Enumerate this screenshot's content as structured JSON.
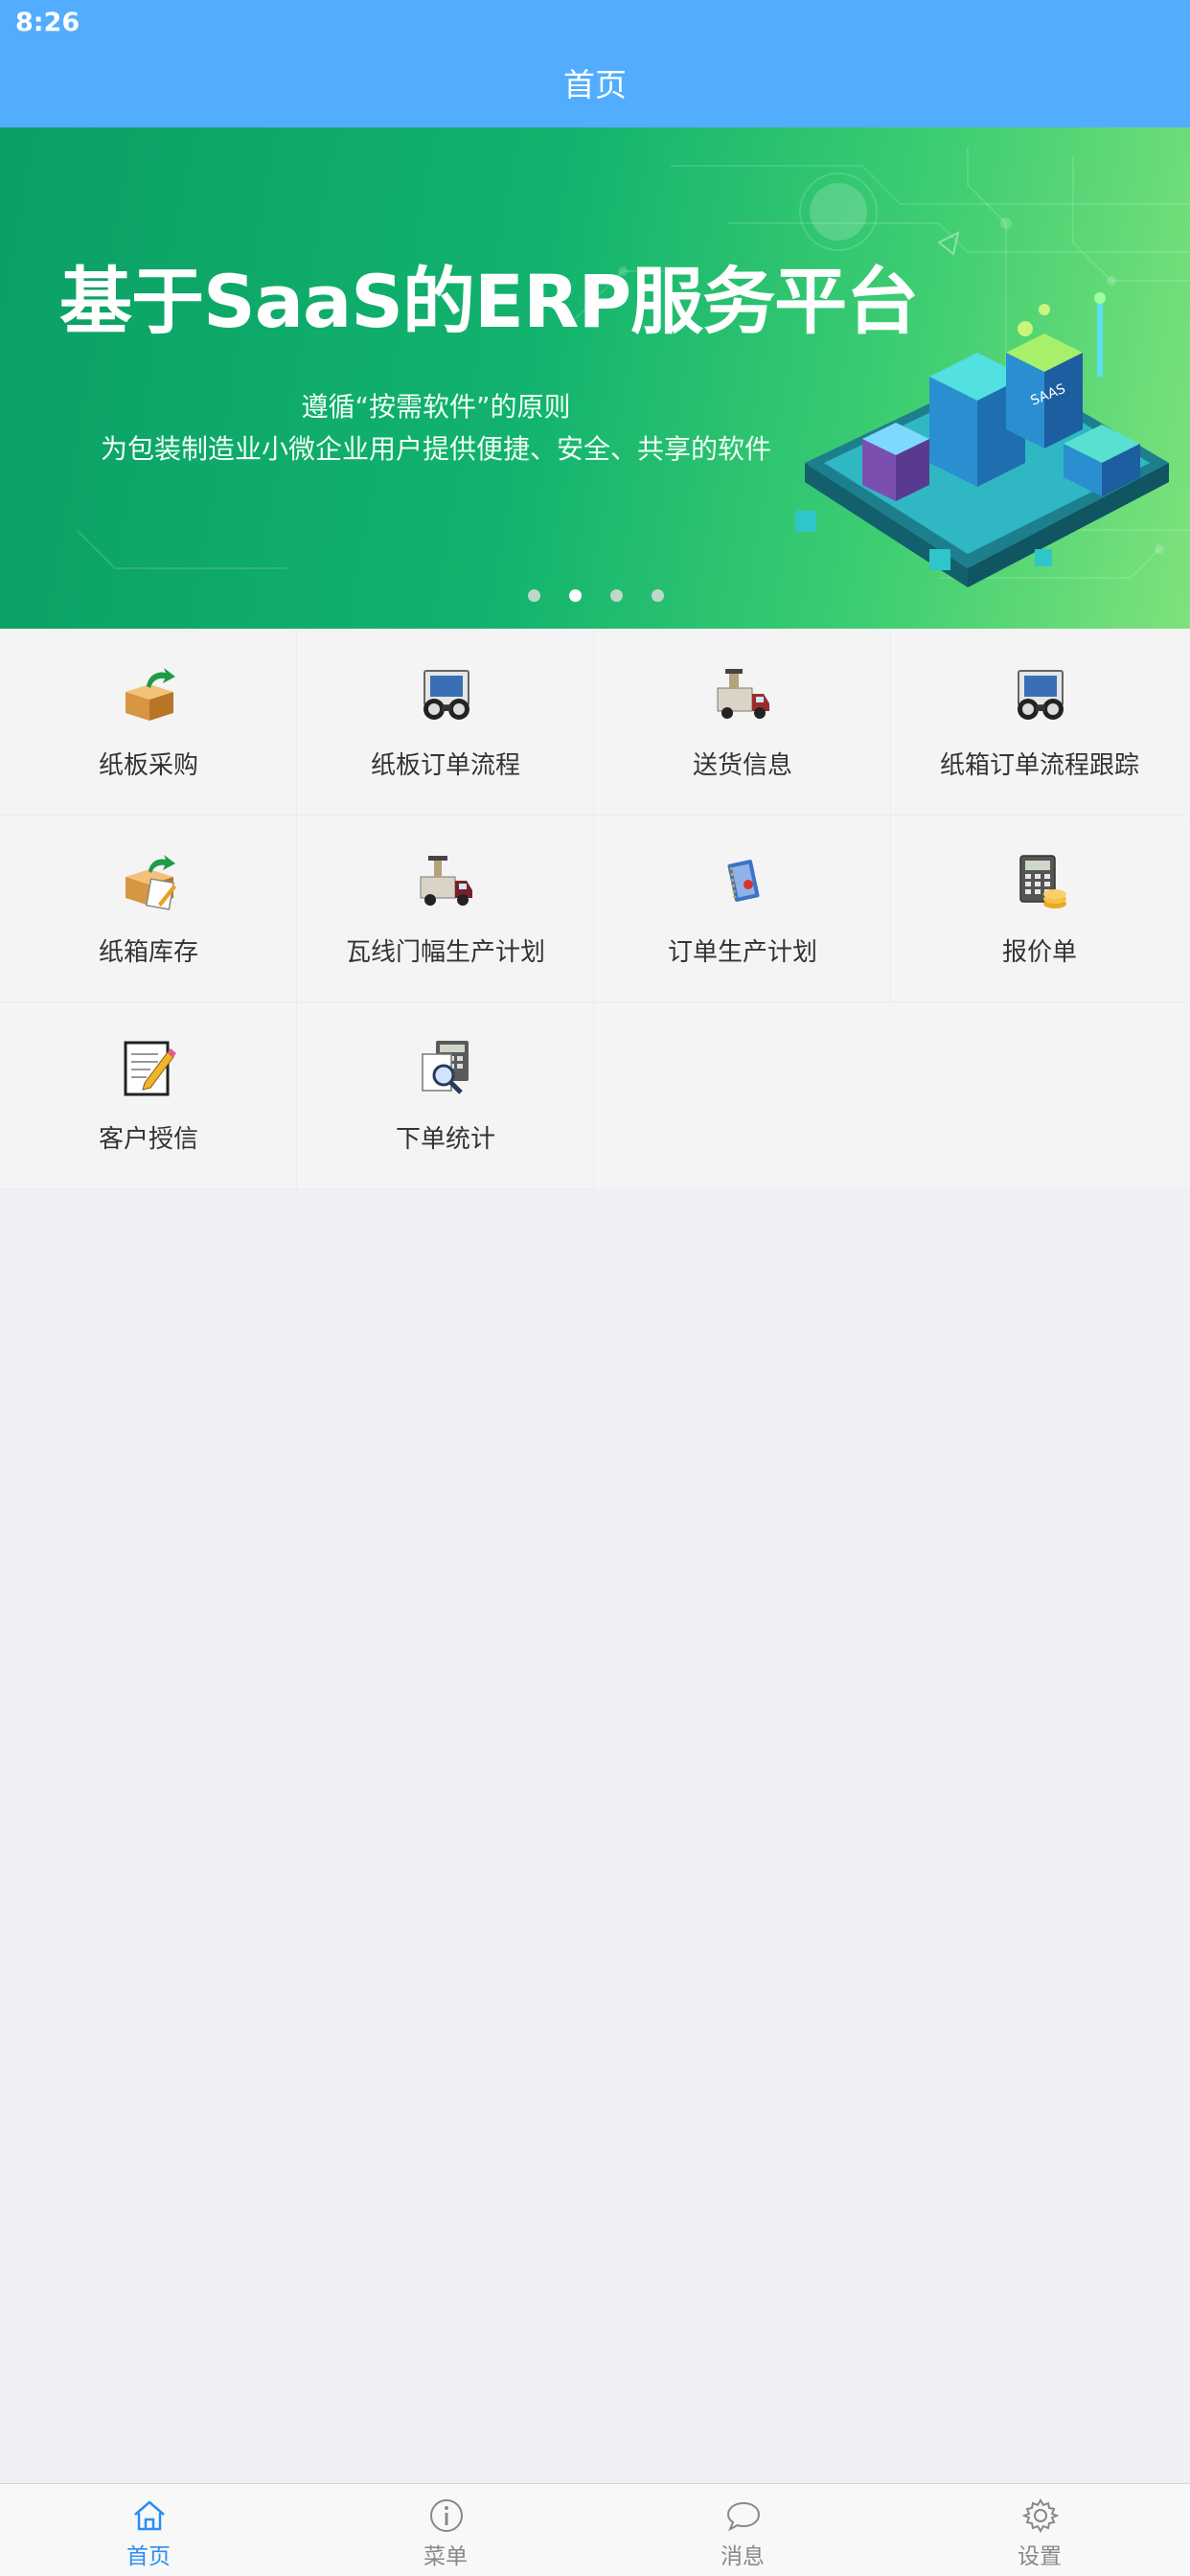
{
  "status_bar": {
    "time": "8:26"
  },
  "nav": {
    "title": "首页"
  },
  "banner": {
    "headline": "基于SaaS的ERP服务平台",
    "subtitle1": "遵循“按需软件”的原则",
    "subtitle2": "为包装制造业小微企业用户提供便捷、安全、共享的软件",
    "illustration_text": "SAAS",
    "active_dot": 2,
    "dot_count": 4
  },
  "menu": [
    {
      "label": "纸板采购",
      "icon": "box-arrow-icon"
    },
    {
      "label": "纸板订单流程",
      "icon": "binoculars-screen-icon"
    },
    {
      "label": "送货信息",
      "icon": "delivery-truck-icon"
    },
    {
      "label": "纸箱订单流程跟踪",
      "icon": "binoculars-screen-icon"
    },
    {
      "label": "纸箱库存",
      "icon": "box-inventory-icon"
    },
    {
      "label": "瓦线门幅生产计划",
      "icon": "production-truck-icon"
    },
    {
      "label": "订单生产计划",
      "icon": "notebook-icon"
    },
    {
      "label": "报价单",
      "icon": "calculator-coins-icon"
    },
    {
      "label": "客户授信",
      "icon": "document-pencil-icon"
    },
    {
      "label": "下单统计",
      "icon": "magnifier-calculator-icon"
    }
  ],
  "tabs": [
    {
      "label": "首页",
      "icon": "home-icon",
      "active": true
    },
    {
      "label": "菜单",
      "icon": "info-icon",
      "active": false
    },
    {
      "label": "消息",
      "icon": "chat-bubble-icon",
      "active": false
    },
    {
      "label": "设置",
      "icon": "gear-icon",
      "active": false
    }
  ],
  "colors": {
    "header": "#52adfe",
    "banner_start": "#0aa064",
    "banner_end": "#7ee27c",
    "tab_active": "#2a8ef3",
    "tab_inactive": "#888888"
  }
}
